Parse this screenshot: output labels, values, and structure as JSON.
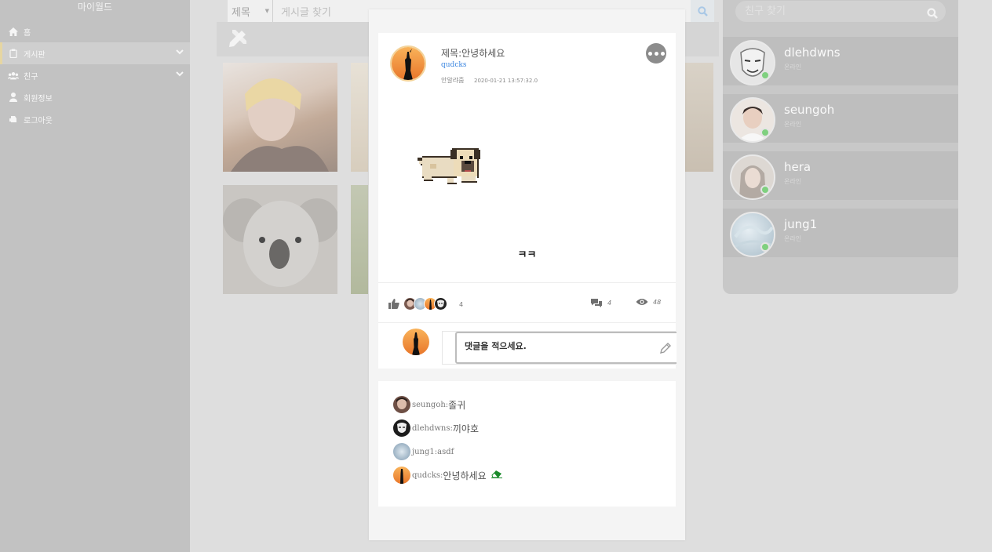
{
  "sidebar": {
    "brand": "마이월드",
    "items": [
      {
        "label": "홈"
      },
      {
        "label": "게시판"
      },
      {
        "label": "친구"
      },
      {
        "label": "회원정보"
      },
      {
        "label": "로그아웃"
      }
    ]
  },
  "search": {
    "filter_value": "제목",
    "placeholder": "게시글 찾기"
  },
  "friends": {
    "search_placeholder": "친구 찾기",
    "list": [
      {
        "name": "dlehdwns",
        "status": "온라인"
      },
      {
        "name": "seungoh",
        "status": "온라인"
      },
      {
        "name": "hera",
        "status": "온라인"
      },
      {
        "name": "jung1",
        "status": "온라인"
      }
    ]
  },
  "post": {
    "title": "제목:안녕하세요",
    "author": "qudcks",
    "mood": "안알랴줌",
    "date": "2020-01-21 13:57:32.0",
    "body": "ㅋㅋ",
    "likes": "4",
    "comment_count": "4",
    "views": "48",
    "comment_placeholder": "댓글을 적으세요."
  },
  "comments": [
    {
      "user": "seungoh:",
      "text": "졸귀"
    },
    {
      "user": "dlehdwns:",
      "text": "끼야호"
    },
    {
      "user": "jung1:",
      "text": "asdf"
    },
    {
      "user": "qudcks:",
      "text": "안녕하세요"
    }
  ],
  "colors": {
    "sidebar_bg": "#c2c2c2",
    "link_blue": "#3b86e0",
    "online_green": "#7fd07f",
    "delete_icon_green": "#1a8a2a"
  },
  "icons": [
    "home-icon",
    "board-icon",
    "friends-icon",
    "user-icon",
    "logout-icon",
    "search-icon",
    "write-icon",
    "more-icon",
    "thumbs-up-icon",
    "comments-icon",
    "eye-icon",
    "pencil-icon",
    "eraser-icon"
  ]
}
